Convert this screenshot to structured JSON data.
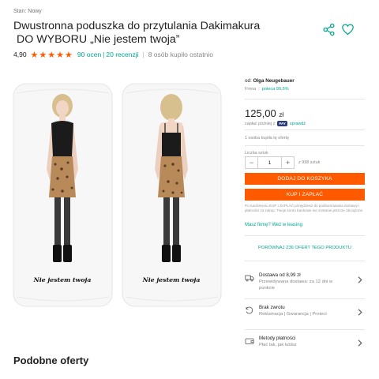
{
  "product": {
    "condition": "Stan: Nowy",
    "title_line1": "Dwustronna poduszka do przytulania Dakimakura",
    "title_line2": "DO WYBORU „Nie jestem twoja”"
  },
  "rating": {
    "score": "4,90",
    "stars": 5,
    "ratings_link": "90 ocen",
    "reviews_link": "20 recenzji",
    "separator": "|",
    "bought": "8 osób kupiło ostatnio"
  },
  "images": {
    "caption": "Nie jestem twoja"
  },
  "seller": {
    "prefix": "od:",
    "name": "Olga Neugebauer",
    "firm": "Firma",
    "separator": "|",
    "recommend": "poleca 99,5%"
  },
  "offer": {
    "price": "125,00",
    "currency": "zł",
    "pay_later_prefix": "zapłać później z",
    "pay_badge": "PAY",
    "pay_later_link": "sprawdź",
    "sold_info": "1 osoba kupiła tę ofertę",
    "qty_label": "Liczba sztuk",
    "qty_minus": "−",
    "qty_value": "1",
    "qty_plus": "+",
    "qty_of": "z 998 sztuk",
    "add_to_cart": "DODAJ DO KOSZYKA",
    "buy_now": "KUP I ZAPŁAĆ",
    "legal": "Po naciśnięciu KUP I ZAPŁAĆ przejdziesz do podsumowania dostawy i płatności za zakup. Twoje konto bankowe nie zostanie jeszcze obciążone.",
    "leasing": "Masz firmę? Weź w leasing",
    "compare": "PORÓWNAJ 236 OFERT TEGO PRODUKTU"
  },
  "info_rows": [
    {
      "title": "Dostawa od 8,99 zł",
      "desc": "Przewidywana dostawa: za 12 dni w punkcie",
      "icon": "truck-icon"
    },
    {
      "title": "Brak zwrotu",
      "desc": "Reklamacja | Gwarancja | Protect",
      "icon": "return-icon"
    },
    {
      "title": "Metody płatności",
      "desc": "Płać tak, jak lubisz",
      "icon": "wallet-icon"
    }
  ],
  "similar": {
    "heading": "Podobne oferty"
  },
  "colors": {
    "accent": "#ff5a00",
    "link": "#00a790",
    "star": "#ff5a00"
  }
}
